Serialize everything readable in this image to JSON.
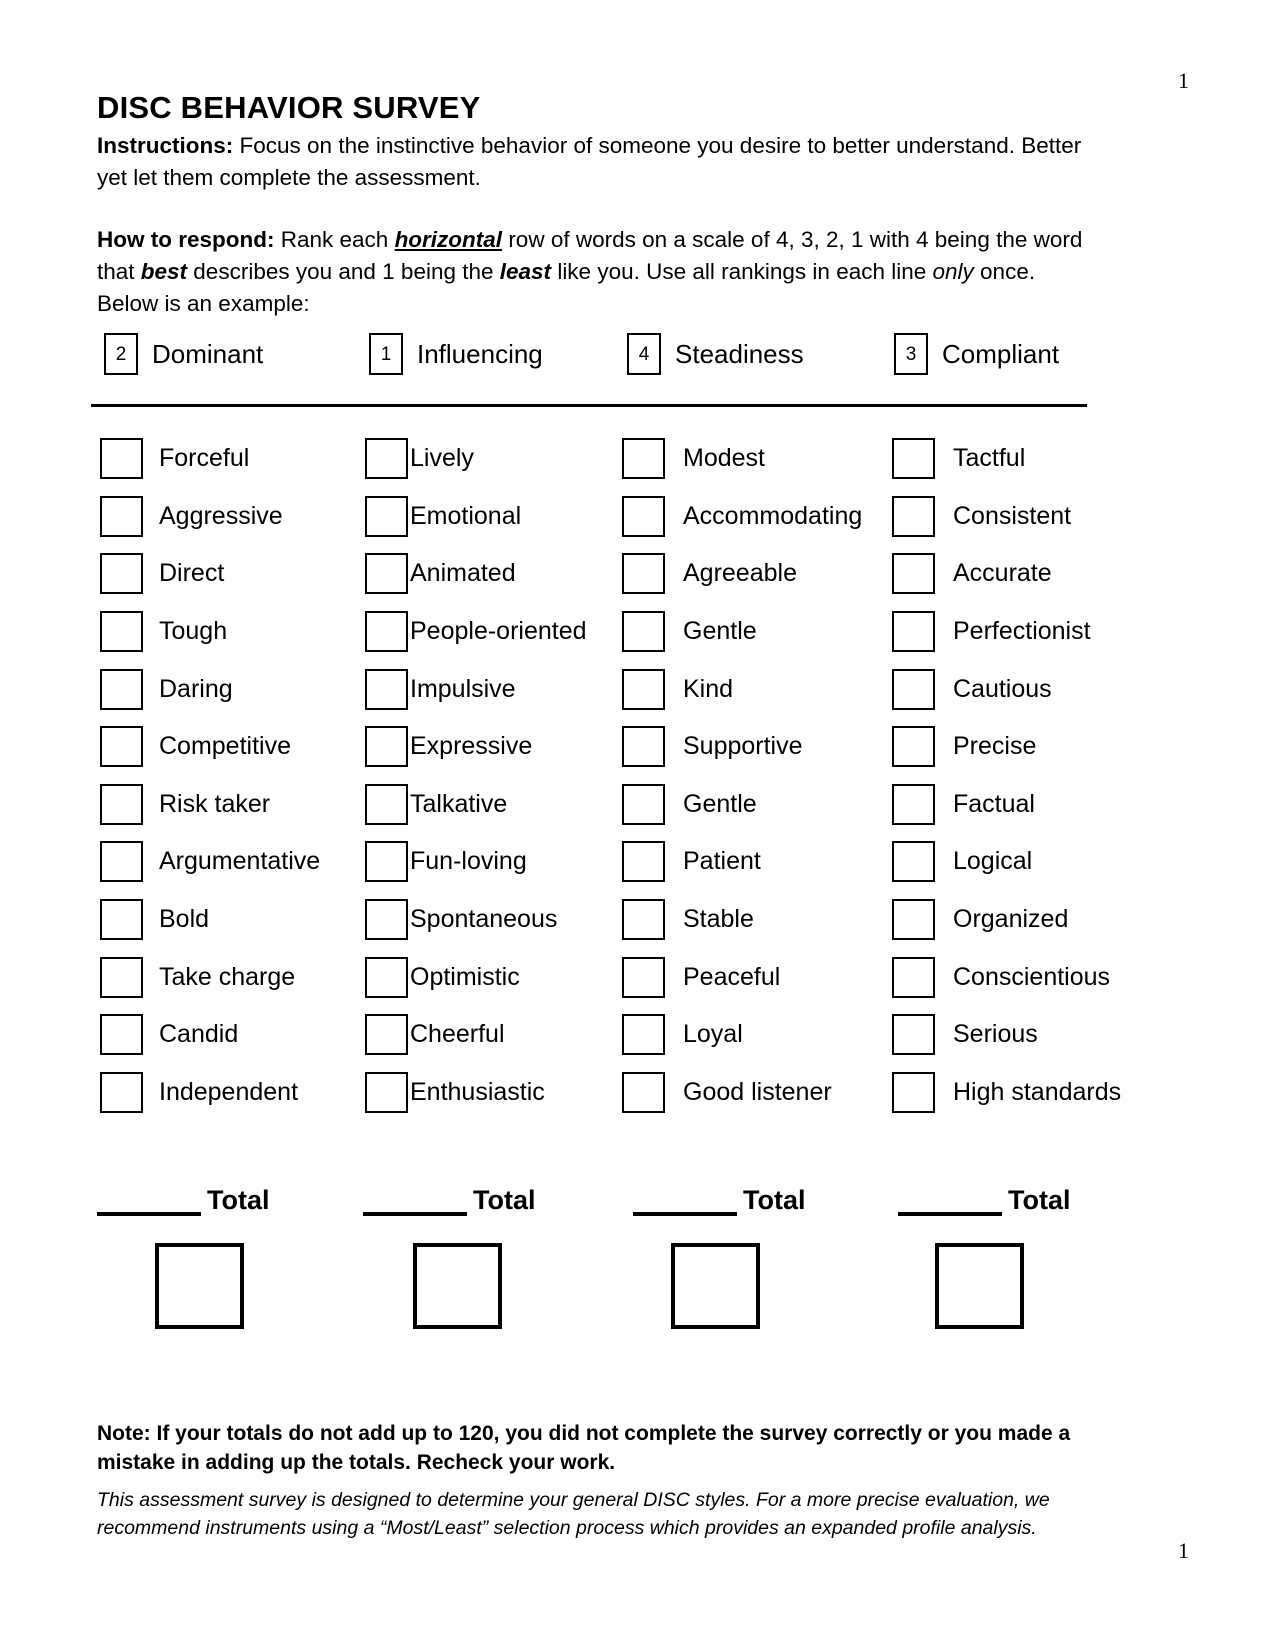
{
  "page": {
    "number_top": "1",
    "number_bottom": "1"
  },
  "header": {
    "title": "DISC BEHAVIOR SURVEY",
    "instructions_label": "Instructions:",
    "instructions_text": " Focus on the instinctive behavior of someone you desire to better understand. Better yet let them complete the assessment.",
    "how_to_label": "How to respond:",
    "how_to_parts": {
      "p1": " Rank each ",
      "em1": "horizontal",
      "p2": " row of words on a scale of 4, 3, 2, 1 with 4 being the word that ",
      "em2": "best",
      "p3": " describes you and 1 being the ",
      "em3": "least",
      "p4": " like you. Use all rankings in each line ",
      "em4": "only",
      "p5": " once. Below is an example:"
    }
  },
  "example": {
    "cells": [
      {
        "value": "2",
        "label": "Dominant"
      },
      {
        "value": "1",
        "label": "Influencing"
      },
      {
        "value": "4",
        "label": "Steadiness"
      },
      {
        "value": "3",
        "label": "Compliant"
      }
    ]
  },
  "columns": [
    {
      "style": "D",
      "words": [
        "Forceful",
        "Aggressive",
        "Direct",
        "Tough",
        "Daring",
        "Competitive",
        "Risk taker",
        "Argumentative",
        "Bold",
        "Take charge",
        "Candid",
        "Independent"
      ]
    },
    {
      "style": "I",
      "words": [
        "Lively",
        "Emotional",
        "Animated",
        "People-oriented",
        "Impulsive",
        "Expressive",
        "Talkative",
        "Fun-loving",
        "Spontaneous",
        "Optimistic",
        "Cheerful",
        "Enthusiastic"
      ]
    },
    {
      "style": "S",
      "words": [
        "Modest",
        "Accommodating",
        "Agreeable",
        "Gentle",
        "Kind",
        "Supportive",
        "Gentle",
        "Patient",
        "Stable",
        "Peaceful",
        "Loyal",
        "Good listener"
      ]
    },
    {
      "style": "C",
      "words": [
        "Tactful",
        "Consistent",
        "Accurate",
        "Perfectionist",
        "Cautious",
        "Precise",
        "Factual",
        "Logical",
        "Organized",
        "Conscientious",
        "Serious",
        "High standards"
      ]
    }
  ],
  "totals": {
    "labels": [
      "Total",
      "Total",
      "Total",
      "Total"
    ]
  },
  "footer": {
    "note": "Note: If your totals do not add up to 120, you did not complete the survey correctly or you made a mistake in adding up the totals. Recheck your work.",
    "disclaimer": "This assessment survey is designed to determine your general DISC styles.  For a more precise evaluation, we recommend instruments using a “Most/Least” selection process which provides an expanded profile analysis."
  },
  "colors": {
    "ink": "#000000",
    "paper": "#ffffff"
  }
}
